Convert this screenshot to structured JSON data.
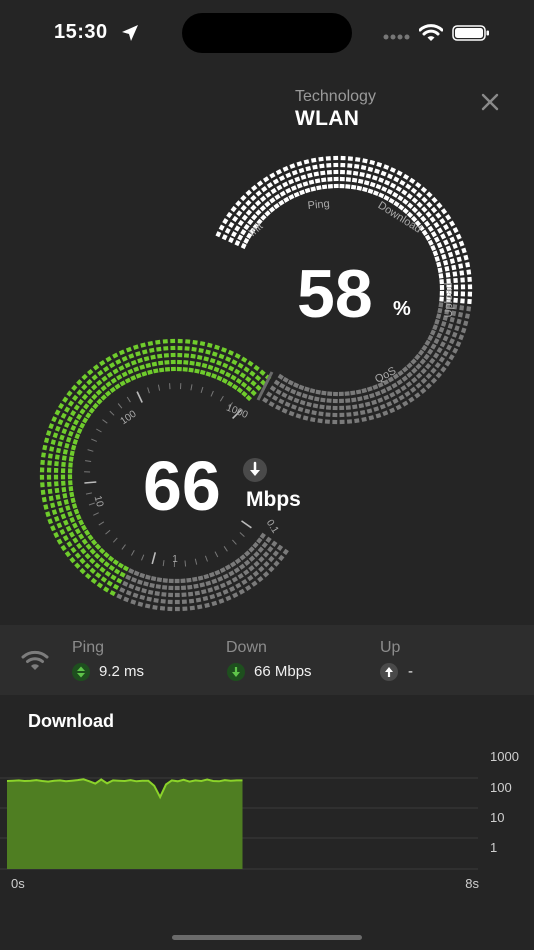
{
  "status_bar": {
    "time": "15:30"
  },
  "header": {
    "technology_label": "Technology",
    "technology_value": "WLAN"
  },
  "progress_gauge": {
    "percent": 58,
    "percent_text": "58",
    "unit": "%",
    "phases": [
      "Init",
      "Ping",
      "Download",
      "Upload",
      "QoS"
    ]
  },
  "speed_gauge": {
    "speed_text": "66",
    "unit": "Mbps",
    "speed_value": 66,
    "scale_labels": [
      "0.1",
      "1",
      "10",
      "100",
      "1000"
    ]
  },
  "stats": {
    "ping": {
      "label": "Ping",
      "value": "9.2 ms"
    },
    "down": {
      "label": "Down",
      "value": "66 Mbps"
    },
    "up": {
      "label": "Up",
      "value": "-"
    }
  },
  "chart_data": {
    "type": "area",
    "title": "Download",
    "x_axis": {
      "start_label": "0s",
      "end_label": "8s",
      "range": [
        0,
        8
      ]
    },
    "y_axis": {
      "scale": "log",
      "ticks": [
        "1000",
        "100",
        "10",
        "1"
      ],
      "range": [
        0.3,
        2000
      ]
    },
    "series": [
      {
        "x": [
          0,
          0.1,
          0.2,
          0.3,
          0.4,
          0.5,
          0.6,
          0.7,
          0.8,
          0.9,
          1.0,
          1.1,
          1.2,
          1.3,
          1.4,
          1.5,
          1.6,
          1.7,
          1.8,
          1.9,
          2.0,
          2.1,
          2.2,
          2.3,
          2.4,
          2.5,
          2.6,
          2.7,
          2.8,
          2.9,
          3.0,
          3.1,
          3.2,
          3.3,
          3.4,
          3.5,
          3.6,
          3.7,
          3.8,
          3.9,
          4.0
        ],
        "y": [
          86,
          88,
          90,
          86,
          88,
          92,
          86,
          82,
          88,
          90,
          84,
          88,
          92,
          98,
          84,
          70,
          96,
          72,
          90,
          88,
          86,
          92,
          84,
          88,
          88,
          60,
          25,
          66,
          90,
          84,
          94,
          82,
          90,
          86,
          96,
          86,
          84,
          92,
          88,
          90,
          90
        ]
      }
    ],
    "colors": {
      "line": "#8bd32a",
      "fill": "#4f7e22"
    }
  },
  "colors": {
    "background": "#252525",
    "accent_green": "#6fcc2c",
    "tile_gray": "#7a7a7a",
    "tile_white": "#ffffff"
  }
}
